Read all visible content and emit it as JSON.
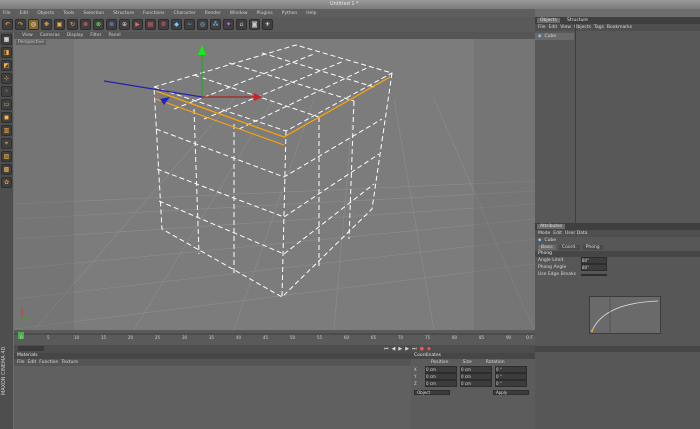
{
  "window": {
    "title": "Untitled 1 *"
  },
  "menubar": {
    "items": [
      "File",
      "Edit",
      "Objects",
      "Tools",
      "Selection",
      "Structure",
      "Functions",
      "Character",
      "Render",
      "Window",
      "Plugins",
      "Python",
      "Help"
    ]
  },
  "toolbar": {
    "icons": [
      "undo-icon",
      "redo-icon",
      "live-select-icon",
      "move-icon",
      "scale-icon",
      "rotate-icon",
      "x-axis-icon",
      "y-axis-icon",
      "z-axis-icon",
      "world-coord-icon",
      "render-view-icon",
      "render-picture-icon",
      "render-settings-icon",
      "cube-icon",
      "spline-icon",
      "nurbs-icon",
      "array-icon",
      "deformer-icon",
      "scene-icon",
      "camera-icon",
      "light-icon"
    ]
  },
  "left_tools": {
    "icons": [
      "make-editable-icon",
      "model-mode-icon",
      "texture-mode-icon",
      "axis-mode-icon",
      "points-mode-icon",
      "edges-mode-icon",
      "polygons-mode-icon",
      "uv-mode-icon",
      "snap-icon",
      "workplane-icon",
      "locked-workplane-icon",
      "sculpt-icon"
    ]
  },
  "viewport": {
    "menu": [
      "View",
      "Cameras",
      "Display",
      "Filter",
      "Panel"
    ],
    "label": "Perspective"
  },
  "timeline": {
    "ticks": [
      "0",
      "5",
      "10",
      "15",
      "20",
      "25",
      "30",
      "35",
      "40",
      "45",
      "50",
      "55",
      "60",
      "65",
      "70",
      "75",
      "80",
      "85",
      "90"
    ],
    "frame": "0 F"
  },
  "material_panel": {
    "title": "Materials",
    "menu": [
      "File",
      "Edit",
      "Function",
      "Texture"
    ]
  },
  "coord_panel": {
    "title": "Coordinates",
    "headers": [
      "Position",
      "Size",
      "Rotation"
    ],
    "rows": [
      {
        "axis": "X",
        "pos": "0 cm",
        "size": "0 cm",
        "rot": "0 °"
      },
      {
        "axis": "Y",
        "pos": "0 cm",
        "size": "0 cm",
        "rot": "0 °"
      },
      {
        "axis": "Z",
        "pos": "0 cm",
        "size": "0 cm",
        "rot": "0 °"
      }
    ],
    "mode": "Object",
    "apply_label": "Apply"
  },
  "object_panel": {
    "tabs": [
      "Objects",
      "Structure"
    ],
    "menu": [
      "File",
      "Edit",
      "View",
      "Objects",
      "Tags",
      "Bookmarks"
    ],
    "object_name": "Cube"
  },
  "attribute_panel": {
    "title": "Attributes",
    "menu": [
      "Mode",
      "Edit",
      "User Data"
    ],
    "object_label": "Cube",
    "tabs": [
      "Basic",
      "Coord.",
      "Phong"
    ],
    "section": "Phong",
    "fields": [
      {
        "label": "Angle Limit",
        "value": "80°"
      },
      {
        "label": "Phong Angle",
        "value": "80°"
      },
      {
        "label": "Use Edge Breaks",
        "value": ""
      }
    ]
  }
}
